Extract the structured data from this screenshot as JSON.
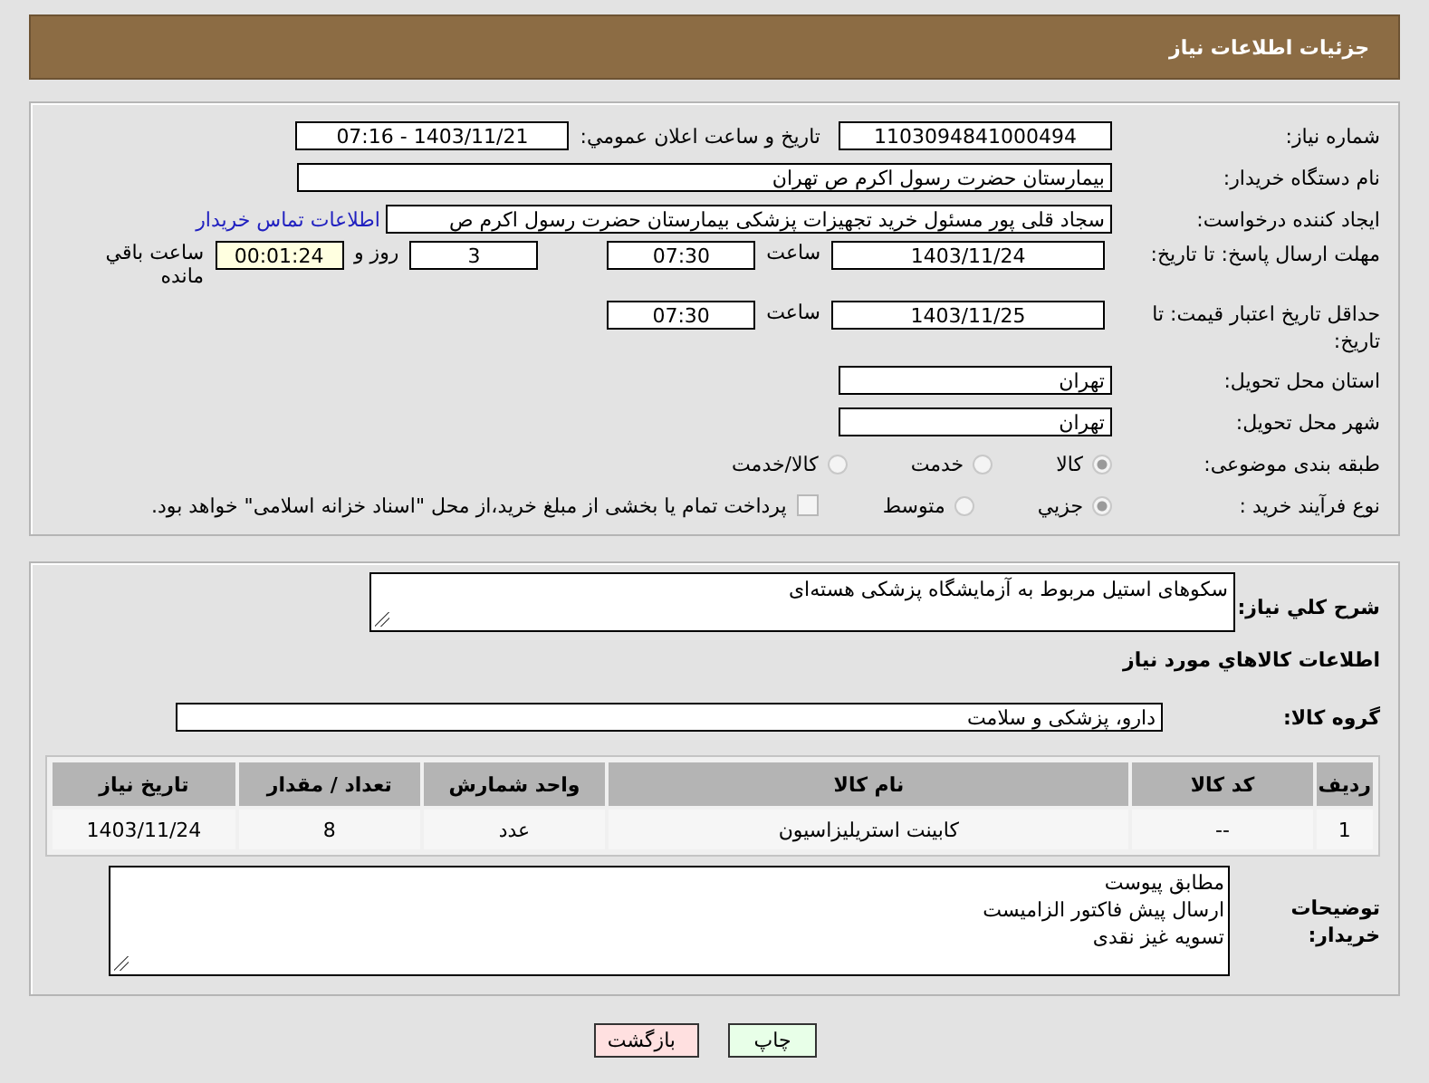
{
  "header": {
    "title": "جزئیات اطلاعات نیاز"
  },
  "need_number": {
    "label": "شماره نیاز:",
    "value": "1103094841000494"
  },
  "announce": {
    "label": "تاریخ و ساعت اعلان عمومي:",
    "value": "1403/11/21 - 07:16"
  },
  "buyer": {
    "label": "نام دستگاه خریدار:",
    "value": "بیمارستان حضرت رسول اکرم ص  تهران"
  },
  "requester": {
    "label": "ایجاد کننده درخواست:",
    "value": "سجاد قلی پور مسئول خرید تجهیزات پزشکی  بیمارستان حضرت رسول اکرم ص",
    "link": "اطلاعات تماس خریدار"
  },
  "deadline": {
    "label": "مهلت ارسال پاسخ: تا تاریخ:",
    "date": "1403/11/24",
    "time_label": "ساعت",
    "time": "07:30",
    "days": "3",
    "days_label": "روز و",
    "remaining": "00:01:24",
    "remaining_label": "ساعت باقي مانده"
  },
  "validity": {
    "label": "حداقل تاریخ اعتبار قیمت: تا تاریخ:",
    "date": "1403/11/25",
    "time_label": "ساعت",
    "time": "07:30"
  },
  "province": {
    "label": "استان محل تحویل:",
    "value": "تهران"
  },
  "city": {
    "label": "شهر محل تحویل:",
    "value": "تهران"
  },
  "category": {
    "label": "طبقه بندی موضوعی:",
    "options": [
      {
        "label": "کالا",
        "selected": true
      },
      {
        "label": "خدمت",
        "selected": false
      },
      {
        "label": "کالا/خدمت",
        "selected": false
      }
    ]
  },
  "process": {
    "label": "نوع فرآیند خرید :",
    "options": [
      {
        "label": "جزیي",
        "selected": true
      },
      {
        "label": "متوسط",
        "selected": false
      }
    ],
    "payment": {
      "label": "پرداخت تمام یا بخشی از مبلغ خرید،از محل \"اسناد خزانه اسلامی\" خواهد بود.",
      "checked": false
    }
  },
  "description": {
    "label": "شرح کلي نیاز:",
    "value": "سکوهای استیل مربوط به آزمایشگاه پزشکی هسته‌ای"
  },
  "items_heading": "اطلاعات کالاهاي مورد نیاز",
  "goods_group": {
    "label": "گروه کالا:",
    "value": "دارو، پزشکی و سلامت"
  },
  "table": {
    "columns": [
      "ردیف",
      "کد کالا",
      "نام کالا",
      "واحد شمارش",
      "تعداد / مقدار",
      "تاریخ نیاز"
    ],
    "rows": [
      [
        "1",
        "--",
        "کابینت استریلیزاسیون",
        "عدد",
        "8",
        "1403/11/24"
      ]
    ]
  },
  "buyer_notes": {
    "label": "توضیحات خریدار:",
    "lines": [
      "مطابق پیوست",
      "ارسال پیش فاکتور الزامیست",
      "تسویه غیز نقدی"
    ]
  },
  "buttons": [
    {
      "label": "چاپ",
      "kind": "print"
    },
    {
      "label": "بازگشت",
      "kind": "back"
    }
  ]
}
